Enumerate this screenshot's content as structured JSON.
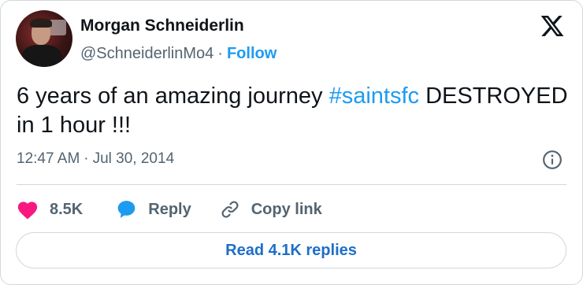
{
  "author": {
    "name": "Morgan Schneiderlin",
    "handle": "@SchneiderlinMo4",
    "separator": "·",
    "follow_label": "Follow"
  },
  "tweet": {
    "text_before": "6 years of an amazing journey ",
    "hashtag": "#saintsfc",
    "text_after": " DESTROYED in 1 hour !!!",
    "time": "12:47 AM",
    "date_separator": "·",
    "date": "Jul 30, 2014"
  },
  "actions": {
    "likes": "8.5K",
    "reply_label": "Reply",
    "copy_link_label": "Copy link"
  },
  "read_replies_label": "Read 4.1K replies",
  "icons": {
    "brand": "x-logo-icon",
    "info": "info-icon",
    "like": "heart-icon",
    "reply": "speech-bubble-icon",
    "copy": "link-icon"
  },
  "colors": {
    "accent": "#1d9bf0",
    "like": "#f91880",
    "muted": "#536471",
    "text": "#0f1419",
    "border": "#cfd9de"
  }
}
